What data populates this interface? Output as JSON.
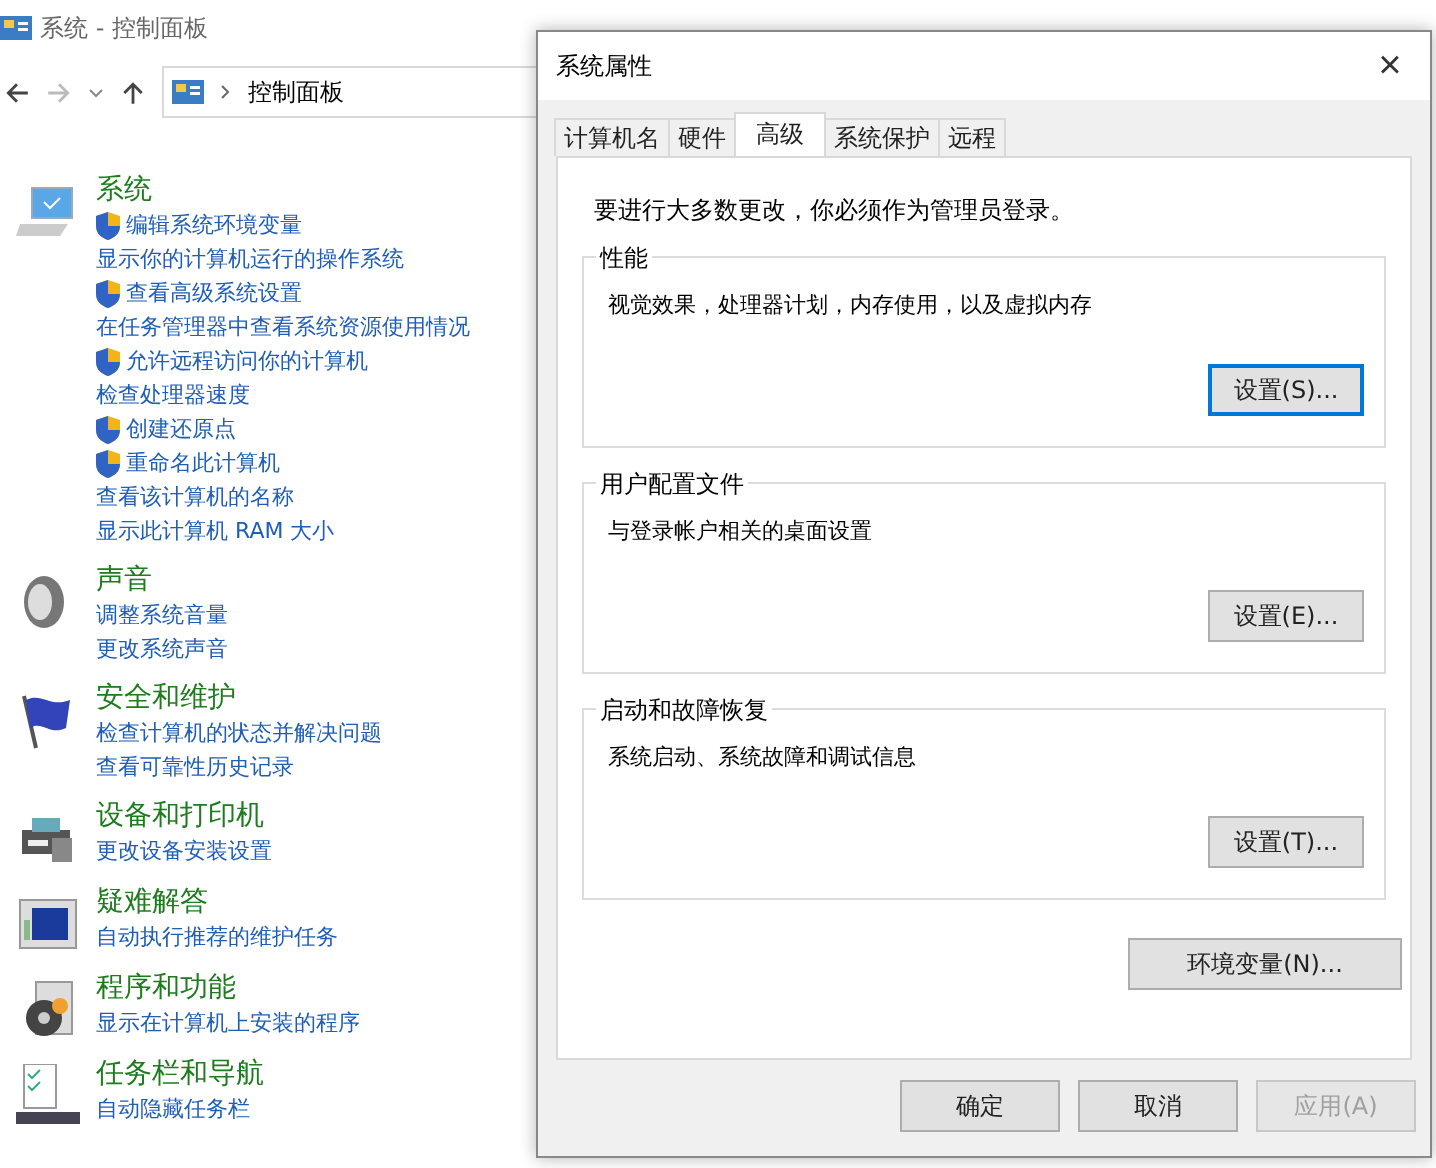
{
  "control_panel": {
    "window_title": "系统 - 控制面板",
    "address": {
      "path": "控制面板"
    },
    "categories": [
      {
        "title": "系统",
        "links": [
          {
            "text": "编辑系统环境变量",
            "shield": true
          },
          {
            "text": "显示你的计算机运行的操作系统",
            "shield": false
          },
          {
            "text": "查看高级系统设置",
            "shield": true
          },
          {
            "text": "在任务管理器中查看系统资源使用情况",
            "shield": false
          },
          {
            "text": "允许远程访问你的计算机",
            "shield": true
          },
          {
            "text": "检查处理器速度",
            "shield": false
          },
          {
            "text": "创建还原点",
            "shield": true
          },
          {
            "text": "重命名此计算机",
            "shield": true
          },
          {
            "text": "查看该计算机的名称",
            "shield": false
          },
          {
            "text": "显示此计算机 RAM 大小",
            "shield": false
          }
        ]
      },
      {
        "title": "声音",
        "links": [
          {
            "text": "调整系统音量",
            "shield": false
          },
          {
            "text": "更改系统声音",
            "shield": false
          }
        ]
      },
      {
        "title": "安全和维护",
        "links": [
          {
            "text": "检查计算机的状态并解决问题",
            "shield": false
          },
          {
            "text": "查看可靠性历史记录",
            "shield": false
          }
        ]
      },
      {
        "title": "设备和打印机",
        "links": [
          {
            "text": "更改设备安装设置",
            "shield": false
          }
        ]
      },
      {
        "title": "疑难解答",
        "links": [
          {
            "text": "自动执行推荐的维护任务",
            "shield": false
          }
        ]
      },
      {
        "title": "程序和功能",
        "links": [
          {
            "text": "显示在计算机上安装的程序",
            "shield": false
          }
        ]
      },
      {
        "title": "任务栏和导航",
        "links": [
          {
            "text": "自动隐藏任务栏",
            "shield": false
          }
        ]
      }
    ]
  },
  "dialog": {
    "title": "系统属性",
    "close": "×",
    "tabs": [
      {
        "label": "计算机名",
        "selected": false
      },
      {
        "label": "硬件",
        "selected": false
      },
      {
        "label": "高级",
        "selected": true
      },
      {
        "label": "系统保护",
        "selected": false
      },
      {
        "label": "远程",
        "selected": false
      }
    ],
    "notice": "要进行大多数更改，你必须作为管理员登录。",
    "groups": [
      {
        "title": "性能",
        "description": "视觉效果，处理器计划，内存使用，以及虚拟内存",
        "button": "设置(S)...",
        "default": true
      },
      {
        "title": "用户配置文件",
        "description": "与登录帐户相关的桌面设置",
        "button": "设置(E)...",
        "default": false
      },
      {
        "title": "启动和故障恢复",
        "description": "系统启动、系统故障和调试信息",
        "button": "设置(T)...",
        "default": false
      }
    ],
    "env_button": "环境变量(N)...",
    "buttons": [
      {
        "label": "确定",
        "disabled": false
      },
      {
        "label": "取消",
        "disabled": false
      },
      {
        "label": "应用(A)",
        "disabled": true
      }
    ]
  }
}
